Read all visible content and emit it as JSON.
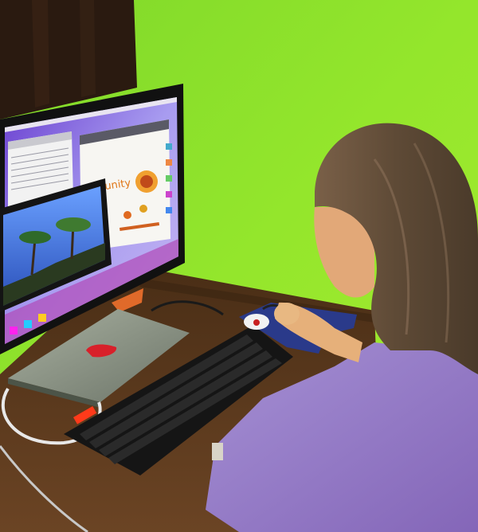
{
  "photo": {
    "monitor_screen": {
      "web_page_heading": "unity"
    },
    "colors": {
      "wall": "#8ee02a",
      "desk": "#5a3a1c",
      "sweater": "#9a7ec4",
      "hair": "#6b5540",
      "screen_glow": "#8a8cf0",
      "led_red": "#ff3a1a"
    }
  }
}
